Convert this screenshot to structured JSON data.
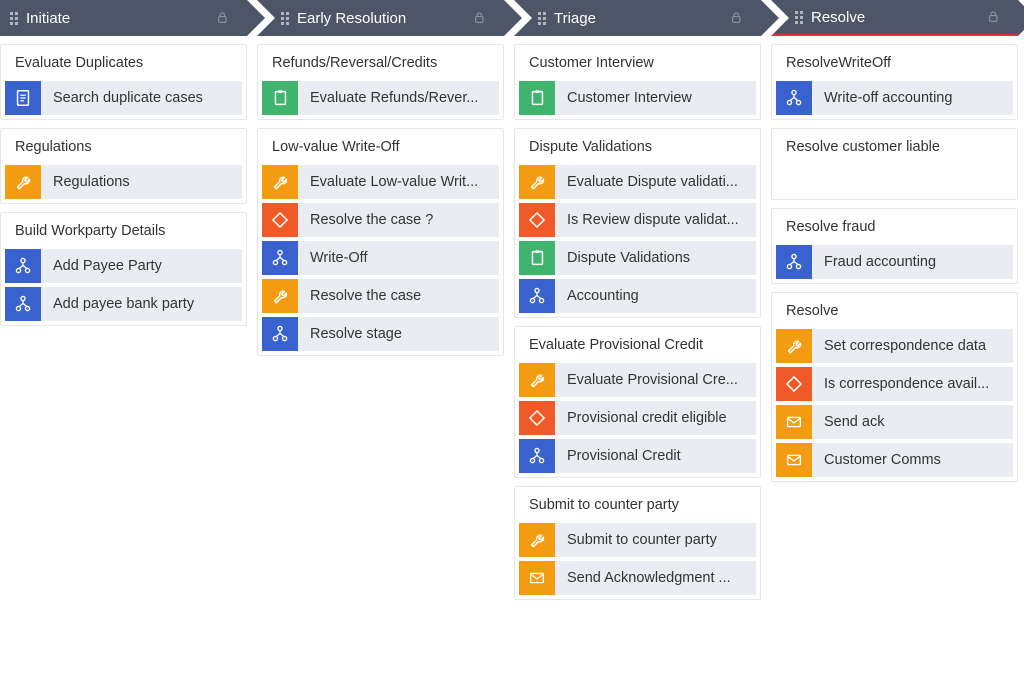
{
  "columns": [
    {
      "title": "Initiate",
      "locked": true,
      "active": false,
      "notch": false,
      "sections": [
        {
          "title": "Evaluate Duplicates",
          "items": [
            {
              "icon": "document",
              "color": "blue",
              "label": "Search duplicate cases"
            }
          ]
        },
        {
          "title": "Regulations",
          "items": [
            {
              "icon": "wrench",
              "color": "orange",
              "label": "Regulations"
            }
          ]
        },
        {
          "title": "Build Workparty Details",
          "items": [
            {
              "icon": "flow",
              "color": "blue",
              "label": "Add Payee Party"
            },
            {
              "icon": "flow",
              "color": "blue",
              "label": "Add payee bank party"
            }
          ]
        }
      ]
    },
    {
      "title": "Early Resolution",
      "locked": true,
      "active": false,
      "notch": true,
      "sections": [
        {
          "title": "Refunds/Reversal/Credits",
          "items": [
            {
              "icon": "clipboard",
              "color": "green",
              "label": "Evaluate Refunds/Rever..."
            }
          ]
        },
        {
          "title": "Low-value Write-Off",
          "items": [
            {
              "icon": "wrench",
              "color": "orange",
              "label": "Evaluate Low-value Writ..."
            },
            {
              "icon": "diamond",
              "color": "dorange",
              "label": "Resolve the case ?"
            },
            {
              "icon": "flow",
              "color": "blue",
              "label": "Write-Off"
            },
            {
              "icon": "wrench",
              "color": "orange",
              "label": "Resolve the case"
            },
            {
              "icon": "flow",
              "color": "blue",
              "label": "Resolve stage"
            }
          ]
        }
      ]
    },
    {
      "title": "Triage",
      "locked": true,
      "active": false,
      "notch": true,
      "sections": [
        {
          "title": "Customer Interview",
          "items": [
            {
              "icon": "clipboard",
              "color": "green",
              "label": "Customer Interview"
            }
          ]
        },
        {
          "title": "Dispute Validations",
          "items": [
            {
              "icon": "wrench",
              "color": "orange",
              "label": "Evaluate Dispute validati..."
            },
            {
              "icon": "diamond",
              "color": "dorange",
              "label": "Is Review dispute validat..."
            },
            {
              "icon": "clipboard",
              "color": "green",
              "label": "Dispute Validations"
            },
            {
              "icon": "flow",
              "color": "blue",
              "label": "Accounting"
            }
          ]
        },
        {
          "title": "Evaluate Provisional Credit",
          "items": [
            {
              "icon": "wrench",
              "color": "orange",
              "label": "Evaluate Provisional Cre..."
            },
            {
              "icon": "diamond",
              "color": "dorange",
              "label": "Provisional credit eligible"
            },
            {
              "icon": "flow",
              "color": "blue",
              "label": "Provisional Credit"
            }
          ]
        },
        {
          "title": "Submit to counter party",
          "items": [
            {
              "icon": "wrench",
              "color": "orange",
              "label": "Submit to counter party"
            },
            {
              "icon": "mail",
              "color": "orange",
              "label": "Send Acknowledgment ..."
            }
          ]
        }
      ]
    },
    {
      "title": "Resolve",
      "locked": true,
      "active": true,
      "notch": true,
      "sections": [
        {
          "title": "ResolveWriteOff",
          "items": [
            {
              "icon": "flow",
              "color": "blue",
              "label": "Write-off accounting"
            }
          ]
        },
        {
          "title": "Resolve customer liable",
          "items": []
        },
        {
          "title": "Resolve fraud",
          "items": [
            {
              "icon": "flow",
              "color": "blue",
              "label": "Fraud accounting"
            }
          ]
        },
        {
          "title": "Resolve",
          "items": [
            {
              "icon": "wrench",
              "color": "orange",
              "label": "Set correspondence data"
            },
            {
              "icon": "diamond",
              "color": "dorange",
              "label": "Is correspondence avail..."
            },
            {
              "icon": "mail",
              "color": "orange",
              "label": "Send ack"
            },
            {
              "icon": "mail",
              "color": "orange",
              "label": "Customer Comms"
            }
          ]
        }
      ]
    }
  ]
}
